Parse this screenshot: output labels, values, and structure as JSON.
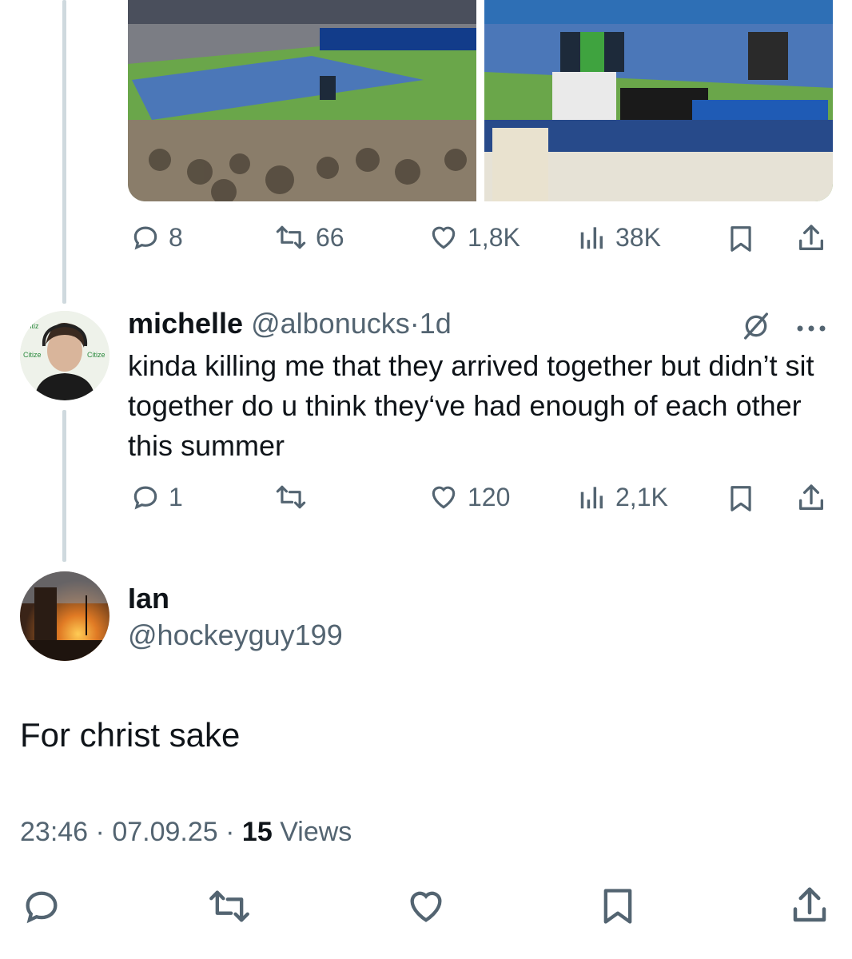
{
  "quoted_tweet": {
    "media": [
      {
        "alt_icon": "stadium-court-photo"
      },
      {
        "alt_icon": "umpire-area-photo"
      }
    ],
    "actions": {
      "replies": "8",
      "retweets": "66",
      "likes": "1,8K",
      "views": "38K"
    }
  },
  "reply_tweet": {
    "display_name": "michelle",
    "handle": "@albonucks",
    "separator": "·",
    "time": "1d",
    "text": "kinda killing me that they arrived together but didn’t sit together do u think they‘ve had enough of each other this summer",
    "actions": {
      "replies": "1",
      "retweets": "",
      "likes": "120",
      "views": "2,1K"
    }
  },
  "main_tweet": {
    "display_name": "Ian",
    "handle": "@hockeyguy199",
    "text": "For christ sake",
    "timestamp_time": "23:46",
    "dot1": "·",
    "timestamp_date": "07.09.25",
    "dot2": "·",
    "views_count": "15",
    "views_label": "Views"
  },
  "colors": {
    "text_primary": "#0f1419",
    "text_secondary": "#536471",
    "thread_line": "#cfd9de",
    "background": "#ffffff"
  }
}
